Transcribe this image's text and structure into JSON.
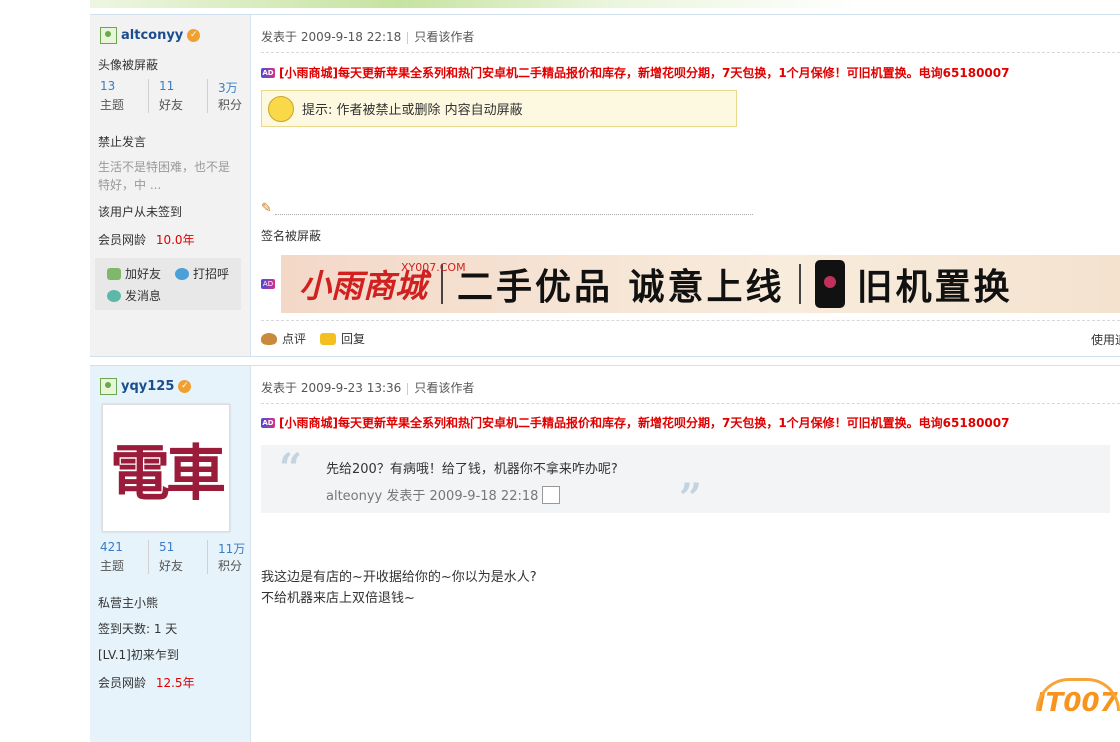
{
  "posts": [
    {
      "username": "altconyy",
      "avatar_text": "头像被屏蔽",
      "stats": [
        {
          "value": "13",
          "label": "主题"
        },
        {
          "value": "11",
          "label": "好友"
        },
        {
          "value": "3万",
          "label": "积分"
        }
      ],
      "group": "禁止发言",
      "signature_preview": "生活不是特困难，也不是特好，中 ...",
      "sign_status": "该用户从未签到",
      "age_label": "会员网龄",
      "age_value": "10.0年",
      "actions": {
        "add_friend": "加好友",
        "greet": "打招呼",
        "message": "发消息"
      },
      "posted": "发表于 2009-9-18 22:18",
      "only_author": "只看该作者",
      "ad": "[小雨商城]每天更新苹果全系列和热门安卓机二手精品报价和库存，新增花呗分期，7天包换，1个月保修！可旧机置换。电询65180007",
      "notice": "提示: 作者被禁止或删除 内容自动屏蔽",
      "signature_blocked": "签名被屏蔽",
      "banner": {
        "logo": "小雨商城",
        "domain": "XY007.COM",
        "slogan1": "二手优品 诚意上线",
        "slogan2": "旧机置换"
      },
      "comment": "点评",
      "reply": "回复",
      "use_text": "使用道"
    },
    {
      "username": "yqy125",
      "avatar_chars": "電車",
      "stats": [
        {
          "value": "421",
          "label": "主题"
        },
        {
          "value": "51",
          "label": "好友"
        },
        {
          "value": "11万",
          "label": "积分"
        }
      ],
      "group": "私营主小熊",
      "sign_days": "签到天数: 1 天",
      "level": "[LV.1]初来乍到",
      "age_label": "会员网龄",
      "age_value": "12.5年",
      "posted": "发表于 2009-9-23 13:36",
      "only_author": "只看该作者",
      "ad": "[小雨商城]每天更新苹果全系列和热门安卓机二手精品报价和库存，新增花呗分期，7天包换，1个月保修！可旧机置换。电询65180007",
      "quote_text": "先给200？有病哦！给了钱，机器你不拿来咋办呢?",
      "quote_by": "alteonyy 发表于 2009-9-18 22:18",
      "body_line1": "我这边是有店的~开收据给你的~你以为是水人?",
      "body_line2": "不给机器来店上双倍退钱~"
    }
  ],
  "watermark": "IT007"
}
